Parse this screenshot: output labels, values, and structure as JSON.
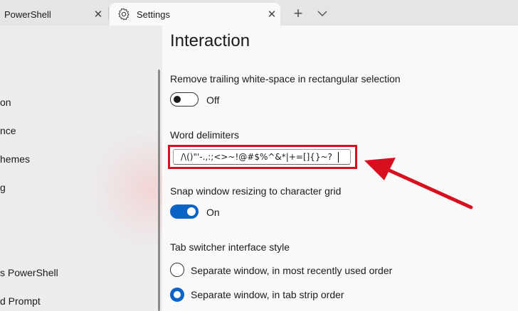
{
  "tabs": [
    {
      "title": "PowerShell"
    },
    {
      "title": "Settings"
    }
  ],
  "tabbar": {
    "new_tab": "+"
  },
  "sidebar": {
    "items": [
      "on",
      "nce",
      "hemes",
      "g",
      "s PowerShell",
      "d Prompt"
    ]
  },
  "content": {
    "title": "Interaction",
    "trailing_whitespace": {
      "label": "Remove trailing white-space in rectangular selection",
      "state": "Off"
    },
    "word_delimiters": {
      "label": "Word delimiters",
      "value": "/\\()\"'-.,:;<>~!@#$%^&*|+=[]{}~?"
    },
    "snap_resize": {
      "label": "Snap window resizing to character grid",
      "state": "On"
    },
    "tab_switcher": {
      "label": "Tab switcher interface style",
      "options": [
        {
          "label": "Separate window, in most recently used order",
          "selected": false
        },
        {
          "label": "Separate window, in tab strip order",
          "selected": true
        }
      ]
    }
  },
  "colors": {
    "accent": "#0a64c8",
    "highlight": "#d80f1e"
  }
}
